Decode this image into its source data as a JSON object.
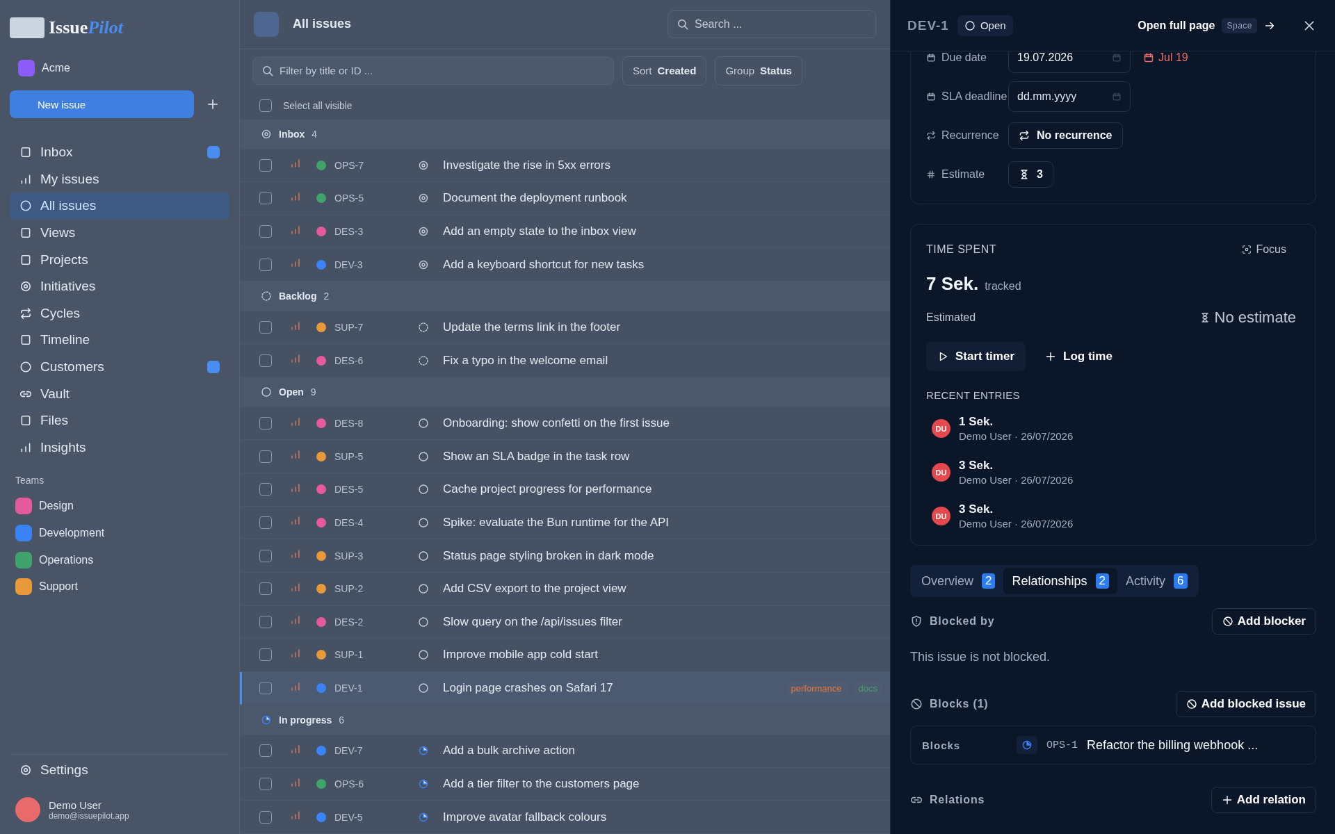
{
  "sidebar": {
    "brand_first": "Issue",
    "brand_second": "Pilot",
    "workspace": "Acme",
    "new_issue": "New issue",
    "nav": [
      {
        "label": "Inbox",
        "selected": false,
        "badge": true
      },
      {
        "label": "My issues",
        "selected": false,
        "badge": false
      },
      {
        "label": "All issues",
        "selected": true,
        "badge": false
      },
      {
        "label": "Views",
        "selected": false,
        "badge": false
      },
      {
        "label": "Projects",
        "selected": false,
        "badge": false
      },
      {
        "label": "Initiatives",
        "selected": false,
        "badge": false
      },
      {
        "label": "Cycles",
        "selected": false,
        "badge": false
      },
      {
        "label": "Timeline",
        "selected": false,
        "badge": false
      },
      {
        "label": "Customers",
        "selected": false,
        "badge": true
      },
      {
        "label": "Vault",
        "selected": false,
        "badge": false
      },
      {
        "label": "Files",
        "selected": false,
        "badge": false
      },
      {
        "label": "Insights",
        "selected": false,
        "badge": false
      }
    ],
    "teams_title": "Teams",
    "teams": [
      {
        "name": "Design",
        "color": "#e55a9b"
      },
      {
        "name": "Development",
        "color": "#3b82f6"
      },
      {
        "name": "Operations",
        "color": "#3fa36b"
      },
      {
        "name": "Support",
        "color": "#e8993a"
      }
    ],
    "settings": "Settings",
    "user_name": "Demo User",
    "user_email": "demo@issuepilot.app"
  },
  "issues": {
    "title": "All issues",
    "search_placeholder": "Search ...",
    "filter_placeholder": "Filter by title or ID ...",
    "sort_label": "Sort",
    "sort_value": "Created",
    "group_label": "Group",
    "group_value": "Status",
    "select_all": "Select all visible",
    "select_all_checked": false,
    "groups": [
      {
        "name": "Inbox",
        "count": "4",
        "kind": "inbox",
        "rows": [
          {
            "id": "OPS-7",
            "color": "#3fa36b",
            "title": "Investigate the rise in 5xx errors",
            "selected": false
          },
          {
            "id": "OPS-5",
            "color": "#3fa36b",
            "title": "Document the deployment runbook",
            "selected": false
          },
          {
            "id": "DES-3",
            "color": "#e55a9b",
            "title": "Add an empty state to the inbox view",
            "selected": false
          },
          {
            "id": "DEV-3",
            "color": "#3b82f6",
            "title": "Add a keyboard shortcut for new tasks",
            "selected": false
          }
        ]
      },
      {
        "name": "Backlog",
        "count": "2",
        "kind": "backlog",
        "rows": [
          {
            "id": "SUP-7",
            "color": "#e8993a",
            "title": "Update the terms link in the footer",
            "selected": false
          },
          {
            "id": "DES-6",
            "color": "#e55a9b",
            "title": "Fix a typo in the welcome email",
            "selected": false
          }
        ]
      },
      {
        "name": "Open",
        "count": "9",
        "kind": "open",
        "rows": [
          {
            "id": "DES-8",
            "color": "#e55a9b",
            "title": "Onboarding: show confetti on the first issue",
            "selected": false
          },
          {
            "id": "SUP-5",
            "color": "#e8993a",
            "title": "Show an SLA badge in the task row",
            "selected": false
          },
          {
            "id": "DES-5",
            "color": "#e55a9b",
            "title": "Cache project progress for performance",
            "selected": false
          },
          {
            "id": "DES-4",
            "color": "#e55a9b",
            "title": "Spike: evaluate the Bun runtime for the API",
            "selected": false
          },
          {
            "id": "SUP-3",
            "color": "#e8993a",
            "title": "Status page styling broken in dark mode",
            "selected": false
          },
          {
            "id": "SUP-2",
            "color": "#e8993a",
            "title": "Add CSV export to the project view",
            "selected": false
          },
          {
            "id": "DES-2",
            "color": "#e55a9b",
            "title": "Slow query on the /api/issues filter",
            "selected": false
          },
          {
            "id": "SUP-1",
            "color": "#e8993a",
            "title": "Improve mobile app cold start",
            "selected": false
          },
          {
            "id": "DEV-1",
            "color": "#3b82f6",
            "title": "Login page crashes on Safari 17",
            "selected": true,
            "labels": [
              {
                "text": "performance",
                "color": "#e8793a"
              },
              {
                "text": "docs",
                "color": "#3fa36b"
              }
            ]
          }
        ]
      },
      {
        "name": "In progress",
        "count": "6",
        "kind": "progress",
        "rows": [
          {
            "id": "DEV-7",
            "color": "#3b82f6",
            "title": "Add a bulk archive action",
            "selected": false
          },
          {
            "id": "OPS-6",
            "color": "#3fa36b",
            "title": "Add a tier filter to the customers page",
            "selected": false
          },
          {
            "id": "DEV-5",
            "color": "#3b82f6",
            "title": "Improve avatar fallback colours",
            "selected": false
          }
        ]
      }
    ]
  },
  "panel": {
    "id": "DEV-1",
    "status": "Open",
    "open_full_page": "Open full page",
    "shortcut": "Space",
    "properties": [
      {
        "kind": "date",
        "label": "Due date",
        "value": "19.07.2026",
        "due": "Jul 19"
      },
      {
        "kind": "date",
        "label": "SLA deadline",
        "placeholder": "dd.mm.yyyy"
      },
      {
        "kind": "chip",
        "label": "Recurrence",
        "value": "No recurrence"
      },
      {
        "kind": "chip",
        "label": "Estimate",
        "value": "3"
      }
    ],
    "time": {
      "title": "TIME SPENT",
      "focus": "Focus",
      "total": "7 Sek.",
      "total_suffix": "tracked",
      "estimated_label": "Estimated",
      "estimate_value": "No estimate",
      "start": "Start timer",
      "log": "Log time",
      "recent_title": "RECENT ENTRIES",
      "entries": [
        {
          "initials": "DU",
          "duration": "1 Sek.",
          "meta": "Demo User · 26/07/2026"
        },
        {
          "initials": "DU",
          "duration": "3 Sek.",
          "meta": "Demo User · 26/07/2026"
        },
        {
          "initials": "DU",
          "duration": "3 Sek.",
          "meta": "Demo User · 26/07/2026"
        }
      ]
    },
    "tabs": [
      {
        "label": "Overview",
        "count": "2",
        "selected": false
      },
      {
        "label": "Relationships",
        "count": "2",
        "selected": true
      },
      {
        "label": "Activity",
        "count": "6",
        "selected": false
      }
    ],
    "blocked_by": {
      "title": "Blocked by",
      "button": "Add blocker",
      "empty": "This issue is not blocked."
    },
    "blocks": {
      "title": "Blocks (1)",
      "button": "Add blocked issue",
      "items": [
        {
          "type": "Blocks",
          "id": "OPS-1",
          "title": "Refactor the billing webhook ..."
        }
      ]
    },
    "relations": {
      "title": "Relations",
      "button": "Add relation"
    }
  }
}
